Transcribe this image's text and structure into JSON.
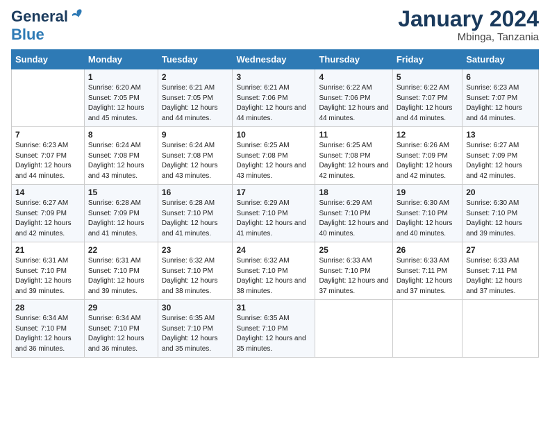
{
  "header": {
    "logo_general": "General",
    "logo_blue": "Blue",
    "main_title": "January 2024",
    "subtitle": "Mbinga, Tanzania"
  },
  "columns": [
    "Sunday",
    "Monday",
    "Tuesday",
    "Wednesday",
    "Thursday",
    "Friday",
    "Saturday"
  ],
  "weeks": [
    [
      {
        "day": "",
        "sunrise": "",
        "sunset": "",
        "daylight": ""
      },
      {
        "day": "1",
        "sunrise": "Sunrise: 6:20 AM",
        "sunset": "Sunset: 7:05 PM",
        "daylight": "Daylight: 12 hours and 45 minutes."
      },
      {
        "day": "2",
        "sunrise": "Sunrise: 6:21 AM",
        "sunset": "Sunset: 7:05 PM",
        "daylight": "Daylight: 12 hours and 44 minutes."
      },
      {
        "day": "3",
        "sunrise": "Sunrise: 6:21 AM",
        "sunset": "Sunset: 7:06 PM",
        "daylight": "Daylight: 12 hours and 44 minutes."
      },
      {
        "day": "4",
        "sunrise": "Sunrise: 6:22 AM",
        "sunset": "Sunset: 7:06 PM",
        "daylight": "Daylight: 12 hours and 44 minutes."
      },
      {
        "day": "5",
        "sunrise": "Sunrise: 6:22 AM",
        "sunset": "Sunset: 7:07 PM",
        "daylight": "Daylight: 12 hours and 44 minutes."
      },
      {
        "day": "6",
        "sunrise": "Sunrise: 6:23 AM",
        "sunset": "Sunset: 7:07 PM",
        "daylight": "Daylight: 12 hours and 44 minutes."
      }
    ],
    [
      {
        "day": "7",
        "sunrise": "Sunrise: 6:23 AM",
        "sunset": "Sunset: 7:07 PM",
        "daylight": "Daylight: 12 hours and 44 minutes."
      },
      {
        "day": "8",
        "sunrise": "Sunrise: 6:24 AM",
        "sunset": "Sunset: 7:08 PM",
        "daylight": "Daylight: 12 hours and 43 minutes."
      },
      {
        "day": "9",
        "sunrise": "Sunrise: 6:24 AM",
        "sunset": "Sunset: 7:08 PM",
        "daylight": "Daylight: 12 hours and 43 minutes."
      },
      {
        "day": "10",
        "sunrise": "Sunrise: 6:25 AM",
        "sunset": "Sunset: 7:08 PM",
        "daylight": "Daylight: 12 hours and 43 minutes."
      },
      {
        "day": "11",
        "sunrise": "Sunrise: 6:25 AM",
        "sunset": "Sunset: 7:08 PM",
        "daylight": "Daylight: 12 hours and 42 minutes."
      },
      {
        "day": "12",
        "sunrise": "Sunrise: 6:26 AM",
        "sunset": "Sunset: 7:09 PM",
        "daylight": "Daylight: 12 hours and 42 minutes."
      },
      {
        "day": "13",
        "sunrise": "Sunrise: 6:27 AM",
        "sunset": "Sunset: 7:09 PM",
        "daylight": "Daylight: 12 hours and 42 minutes."
      }
    ],
    [
      {
        "day": "14",
        "sunrise": "Sunrise: 6:27 AM",
        "sunset": "Sunset: 7:09 PM",
        "daylight": "Daylight: 12 hours and 42 minutes."
      },
      {
        "day": "15",
        "sunrise": "Sunrise: 6:28 AM",
        "sunset": "Sunset: 7:09 PM",
        "daylight": "Daylight: 12 hours and 41 minutes."
      },
      {
        "day": "16",
        "sunrise": "Sunrise: 6:28 AM",
        "sunset": "Sunset: 7:10 PM",
        "daylight": "Daylight: 12 hours and 41 minutes."
      },
      {
        "day": "17",
        "sunrise": "Sunrise: 6:29 AM",
        "sunset": "Sunset: 7:10 PM",
        "daylight": "Daylight: 12 hours and 41 minutes."
      },
      {
        "day": "18",
        "sunrise": "Sunrise: 6:29 AM",
        "sunset": "Sunset: 7:10 PM",
        "daylight": "Daylight: 12 hours and 40 minutes."
      },
      {
        "day": "19",
        "sunrise": "Sunrise: 6:30 AM",
        "sunset": "Sunset: 7:10 PM",
        "daylight": "Daylight: 12 hours and 40 minutes."
      },
      {
        "day": "20",
        "sunrise": "Sunrise: 6:30 AM",
        "sunset": "Sunset: 7:10 PM",
        "daylight": "Daylight: 12 hours and 39 minutes."
      }
    ],
    [
      {
        "day": "21",
        "sunrise": "Sunrise: 6:31 AM",
        "sunset": "Sunset: 7:10 PM",
        "daylight": "Daylight: 12 hours and 39 minutes."
      },
      {
        "day": "22",
        "sunrise": "Sunrise: 6:31 AM",
        "sunset": "Sunset: 7:10 PM",
        "daylight": "Daylight: 12 hours and 39 minutes."
      },
      {
        "day": "23",
        "sunrise": "Sunrise: 6:32 AM",
        "sunset": "Sunset: 7:10 PM",
        "daylight": "Daylight: 12 hours and 38 minutes."
      },
      {
        "day": "24",
        "sunrise": "Sunrise: 6:32 AM",
        "sunset": "Sunset: 7:10 PM",
        "daylight": "Daylight: 12 hours and 38 minutes."
      },
      {
        "day": "25",
        "sunrise": "Sunrise: 6:33 AM",
        "sunset": "Sunset: 7:10 PM",
        "daylight": "Daylight: 12 hours and 37 minutes."
      },
      {
        "day": "26",
        "sunrise": "Sunrise: 6:33 AM",
        "sunset": "Sunset: 7:11 PM",
        "daylight": "Daylight: 12 hours and 37 minutes."
      },
      {
        "day": "27",
        "sunrise": "Sunrise: 6:33 AM",
        "sunset": "Sunset: 7:11 PM",
        "daylight": "Daylight: 12 hours and 37 minutes."
      }
    ],
    [
      {
        "day": "28",
        "sunrise": "Sunrise: 6:34 AM",
        "sunset": "Sunset: 7:10 PM",
        "daylight": "Daylight: 12 hours and 36 minutes."
      },
      {
        "day": "29",
        "sunrise": "Sunrise: 6:34 AM",
        "sunset": "Sunset: 7:10 PM",
        "daylight": "Daylight: 12 hours and 36 minutes."
      },
      {
        "day": "30",
        "sunrise": "Sunrise: 6:35 AM",
        "sunset": "Sunset: 7:10 PM",
        "daylight": "Daylight: 12 hours and 35 minutes."
      },
      {
        "day": "31",
        "sunrise": "Sunrise: 6:35 AM",
        "sunset": "Sunset: 7:10 PM",
        "daylight": "Daylight: 12 hours and 35 minutes."
      },
      {
        "day": "",
        "sunrise": "",
        "sunset": "",
        "daylight": ""
      },
      {
        "day": "",
        "sunrise": "",
        "sunset": "",
        "daylight": ""
      },
      {
        "day": "",
        "sunrise": "",
        "sunset": "",
        "daylight": ""
      }
    ]
  ]
}
